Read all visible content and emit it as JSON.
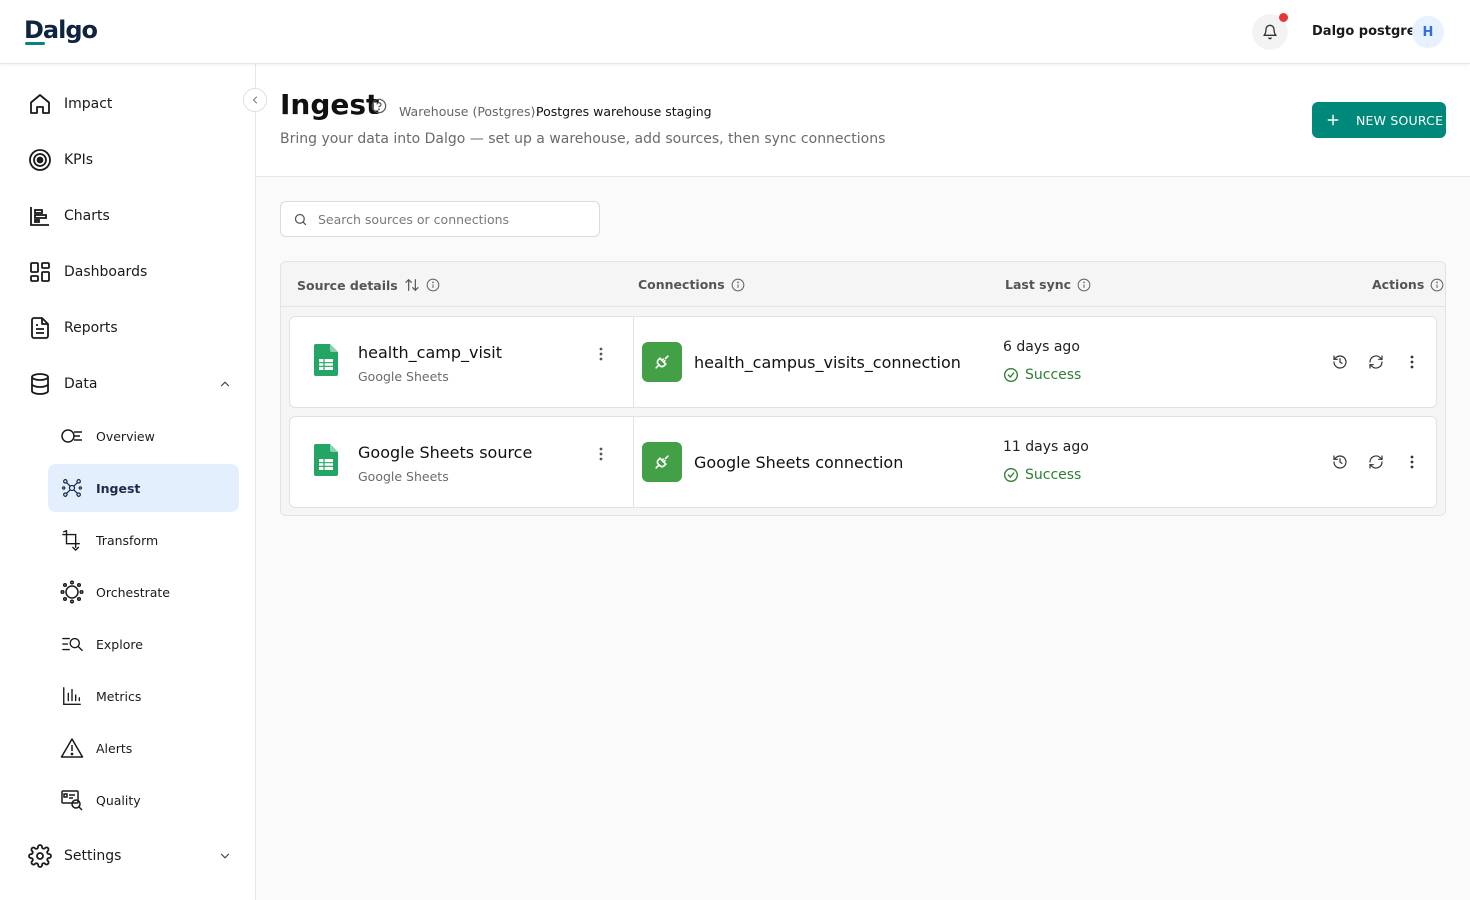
{
  "app": {
    "logo": "Dalgo",
    "user_name": "Dalgo postgres",
    "avatar_initial": "H",
    "accent_color": "#00897b",
    "notification_dot_color": "#e53935"
  },
  "sidebar": {
    "items": [
      {
        "label": "Impact",
        "icon": "home-icon"
      },
      {
        "label": "KPIs",
        "icon": "target-icon"
      },
      {
        "label": "Charts",
        "icon": "chart-icon"
      },
      {
        "label": "Dashboards",
        "icon": "dashboard-icon"
      },
      {
        "label": "Reports",
        "icon": "report-icon"
      },
      {
        "label": "Data",
        "icon": "database-icon",
        "expanded": true
      },
      {
        "label": "Settings",
        "icon": "gear-icon",
        "expanded": false
      }
    ],
    "data_subitems": [
      {
        "label": "Overview",
        "icon": "overview-icon"
      },
      {
        "label": "Ingest",
        "icon": "ingest-icon",
        "active": true
      },
      {
        "label": "Transform",
        "icon": "transform-icon"
      },
      {
        "label": "Orchestrate",
        "icon": "orchestrate-icon"
      },
      {
        "label": "Explore",
        "icon": "explore-icon"
      },
      {
        "label": "Metrics",
        "icon": "metrics-icon"
      },
      {
        "label": "Alerts",
        "icon": "alert-icon"
      },
      {
        "label": "Quality",
        "icon": "quality-icon"
      }
    ]
  },
  "header": {
    "title": "Ingest",
    "warehouse_label": "Warehouse (Postgres):",
    "warehouse_value": "Postgres warehouse staging",
    "subtitle": "Bring your data into Dalgo — set up a warehouse, add sources, then sync connections",
    "new_source_label": "NEW SOURCE"
  },
  "search": {
    "placeholder": "Search sources or connections",
    "value": ""
  },
  "table": {
    "columns": [
      "Source details",
      "Connections",
      "Last sync",
      "Actions"
    ],
    "rows": [
      {
        "source_name": "health_camp_visit",
        "source_type": "Google Sheets",
        "connection_name": "health_campus_visits_connection",
        "last_sync": "6 days ago",
        "status": "Success"
      },
      {
        "source_name": "Google Sheets source",
        "source_type": "Google Sheets",
        "connection_name": "Google Sheets connection",
        "last_sync": "11 days ago",
        "status": "Success"
      }
    ]
  }
}
